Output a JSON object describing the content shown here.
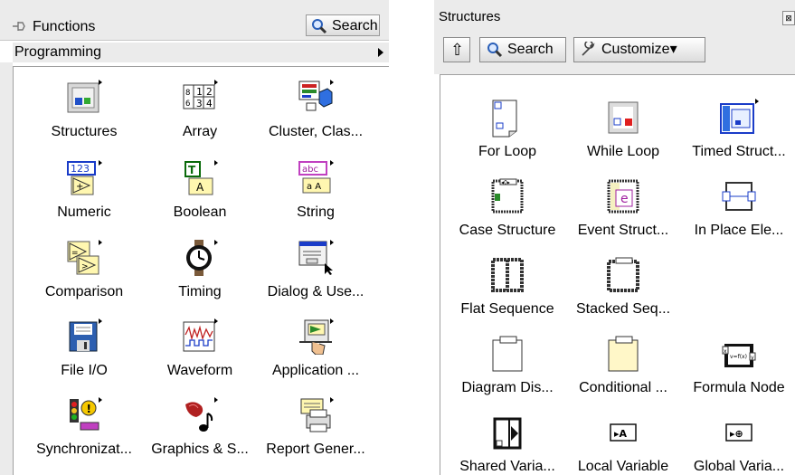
{
  "functions_palette": {
    "title": "Functions",
    "search_label": "Search",
    "category": "Programming",
    "items": [
      {
        "label": "Structures",
        "icon": "structures-icon"
      },
      {
        "label": "Array",
        "icon": "array-icon"
      },
      {
        "label": "Cluster, Clas...",
        "icon": "cluster-icon"
      },
      {
        "label": "Numeric",
        "icon": "numeric-icon"
      },
      {
        "label": "Boolean",
        "icon": "boolean-icon"
      },
      {
        "label": "String",
        "icon": "string-icon"
      },
      {
        "label": "Comparison",
        "icon": "comparison-icon"
      },
      {
        "label": "Timing",
        "icon": "timing-icon"
      },
      {
        "label": "Dialog & Use...",
        "icon": "dialog-icon"
      },
      {
        "label": "File I/O",
        "icon": "file-io-icon"
      },
      {
        "label": "Waveform",
        "icon": "waveform-icon"
      },
      {
        "label": "Application ...",
        "icon": "application-icon"
      },
      {
        "label": "Synchronizat...",
        "icon": "synchronization-icon"
      },
      {
        "label": "Graphics & S...",
        "icon": "graphics-sound-icon"
      },
      {
        "label": "Report Gener...",
        "icon": "report-generation-icon"
      }
    ],
    "icon_texts": {
      "array": [
        "8",
        "1",
        "2",
        "6",
        "3",
        "4"
      ],
      "numeric": "123",
      "boolean": [
        "T",
        "A"
      ],
      "string": [
        "abc",
        "a A"
      ]
    }
  },
  "structures_palette": {
    "title": "Structures",
    "close_glyph": "⊠",
    "up_icon": "⇧",
    "search_label": "Search",
    "customize_label": "Customize▾",
    "items": [
      {
        "label": "For Loop",
        "icon": "for-loop-icon"
      },
      {
        "label": "While Loop",
        "icon": "while-loop-icon"
      },
      {
        "label": "Timed Struct...",
        "icon": "timed-structure-icon"
      },
      {
        "label": "Case Structure",
        "icon": "case-structure-icon"
      },
      {
        "label": "Event Struct...",
        "icon": "event-structure-icon"
      },
      {
        "label": "In Place Ele...",
        "icon": "in-place-element-icon"
      },
      {
        "label": "Flat Sequence",
        "icon": "flat-sequence-icon"
      },
      {
        "label": "Stacked Seq...",
        "icon": "stacked-sequence-icon"
      },
      {
        "label": "Diagram Dis...",
        "icon": "diagram-disable-icon"
      },
      {
        "label": "Conditional ...",
        "icon": "conditional-disable-icon"
      },
      {
        "label": "Formula Node",
        "icon": "formula-node-icon"
      },
      {
        "label": "Shared Varia...",
        "icon": "shared-variable-icon"
      },
      {
        "label": "Local Variable",
        "icon": "local-variable-icon"
      },
      {
        "label": "Global Varia...",
        "icon": "global-variable-icon"
      }
    ],
    "icon_texts": {
      "event": "e",
      "formula": "v=f(x)",
      "formula_in": "x",
      "formula_out": "y",
      "case_tab": "◂0▸",
      "local": "▸A",
      "global": "▸⊕"
    }
  },
  "colors": {
    "panel_bg": "#ebebeb",
    "border": "#a0a0a0",
    "accent_blue": "#1a3cc8",
    "accent_yellow": "#f5e9a0"
  }
}
